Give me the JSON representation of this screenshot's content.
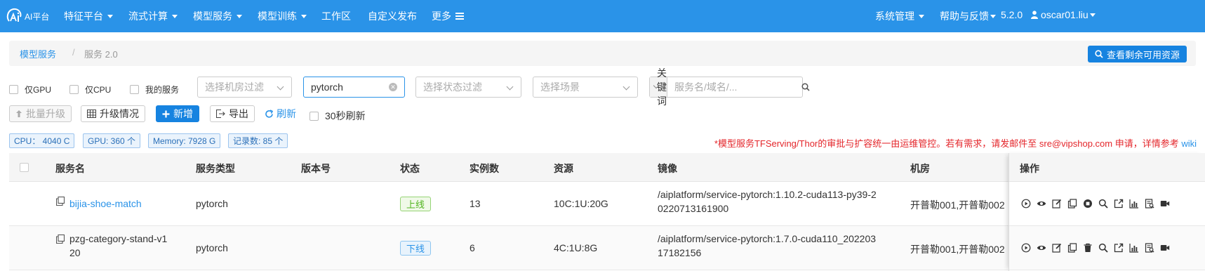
{
  "navbar": {
    "logo_text": "AI平台",
    "items": [
      {
        "label": "特征平台",
        "has_caret": true
      },
      {
        "label": "流式计算",
        "has_caret": true
      },
      {
        "label": "模型服务",
        "has_caret": true
      },
      {
        "label": "模型训练",
        "has_caret": true
      },
      {
        "label": "工作区",
        "has_caret": false
      },
      {
        "label": "自定义发布",
        "has_caret": false
      },
      {
        "label": "更多",
        "has_caret": false
      }
    ],
    "right": {
      "system_admin": "系统管理",
      "help": "帮助与反馈",
      "version": "5.2.0",
      "user": "oscar01.liu"
    },
    "color": "#2a93e8"
  },
  "breadcrumb": {
    "root": "模型服务",
    "separator": "/",
    "current": "服务 2.0",
    "resources_button": "查看剩余可用资源"
  },
  "filters": {
    "gpu_only": "仅GPU",
    "cpu_only": "仅CPU",
    "my_services": "我的服务",
    "room_placeholder": "选择机房过滤",
    "type_value": "pytorch",
    "status_placeholder": "选择状态过滤",
    "scene_placeholder": "选择场景",
    "keyword_select": "关键词",
    "keyword_placeholder": "服务名/域名/..."
  },
  "actions": {
    "batch_upgrade": "批量升级",
    "upgrade_status": "升级情况",
    "add": "新增",
    "export": "导出",
    "refresh": "刷新",
    "auto_refresh": "30秒刷新"
  },
  "stats": {
    "cpu": "CPU：  4040 C",
    "gpu": "GPU: 360 个",
    "memory": "Memory: 7928 G",
    "records": "记录数: 85 个"
  },
  "notice": {
    "text": "*模型服务TFServing/Thor的审批与扩容统一由运维管控。若有需求，请发邮件至 sre@vipshop.com 申请，详情参考 ",
    "link": "wiki"
  },
  "table": {
    "headers": {
      "name": "服务名",
      "type": "服务类型",
      "version": "版本号",
      "status": "状态",
      "instances": "实例数",
      "resources": "资源",
      "image": "镜像",
      "room": "机房",
      "ops": "操作"
    },
    "rows": [
      {
        "name": "bijia-shoe-match",
        "type": "pytorch",
        "version": "",
        "status": "上线",
        "instances": "13",
        "resources": "10C:1U:20G",
        "image_line1": "/aiplatform/service-pytorch:1.10.2-cuda113-py39-2",
        "image_line2": "0220713161900",
        "room": "开普勒001,开普勒002",
        "ops": [
          "play-icon",
          "eye-icon",
          "edit-icon",
          "copy-icon",
          "stop-icon",
          "search-icon",
          "external-link-icon",
          "chart-icon",
          "log-icon",
          "video-icon"
        ]
      },
      {
        "name_line1": "pzg-category-stand-v1",
        "name_line2": "20",
        "type": "pytorch",
        "version": "",
        "status": "下线",
        "instances": "6",
        "resources": "4C:1U:8G",
        "image_line1": "/aiplatform/service-pytorch:1.7.0-cuda110_202203",
        "image_line2": "17182156",
        "room": "开普勒001,开普勒002",
        "ops": [
          "play-icon",
          "eye-icon",
          "edit-icon",
          "copy-icon",
          "delete-icon",
          "search-icon",
          "external-link-icon",
          "chart-icon",
          "log-icon",
          "video-icon"
        ]
      }
    ]
  }
}
